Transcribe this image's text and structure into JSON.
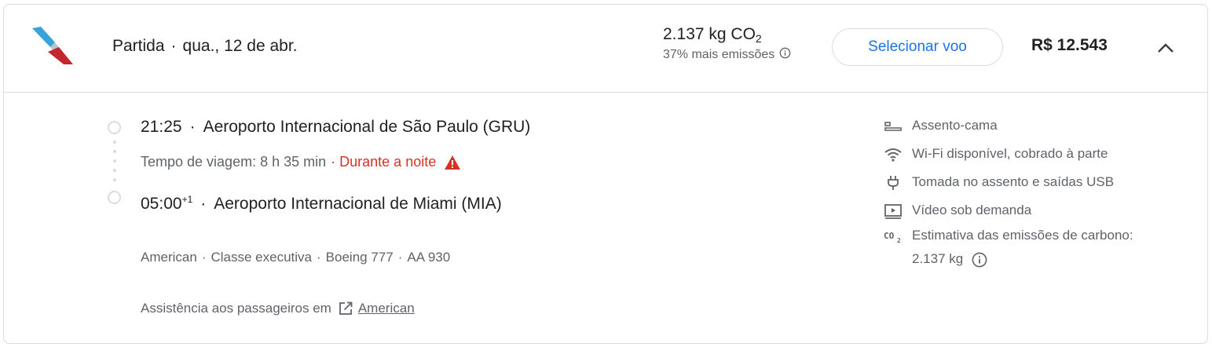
{
  "header": {
    "direction_label": "Partida",
    "date": "qua., 12 de abr.",
    "emissions_value": "2.137 kg CO",
    "emissions_sub": "2",
    "emissions_note": "37% mais emissões",
    "select_button": "Selecionar voo",
    "price": "R$ 12.543"
  },
  "segment": {
    "departure_time": "21:25",
    "departure_airport": "Aeroporto Internacional de São Paulo (GRU)",
    "travel_time": "Tempo de viagem: 8 h 35 min",
    "overnight_label": "Durante a noite",
    "arrival_time": "05:00",
    "arrival_day_offset": "+1",
    "arrival_airport": "Aeroporto Internacional de Miami (MIA)"
  },
  "details": {
    "airline": "American",
    "cabin": "Classe executiva",
    "aircraft": "Boeing 777",
    "flight_number": "AA 930"
  },
  "assistance": {
    "prefix": "Assistência aos passageiros em",
    "link": "American"
  },
  "amenities": [
    {
      "icon": "bed-seat-icon",
      "label": "Assento-cama"
    },
    {
      "icon": "wifi-icon",
      "label": "Wi-Fi disponível, cobrado à parte"
    },
    {
      "icon": "power-plug-icon",
      "label": "Tomada no assento e saídas USB"
    },
    {
      "icon": "video-icon",
      "label": "Vídeo sob demanda"
    },
    {
      "icon": "co2-icon",
      "label": "Estimativa das emissões de carbono:",
      "label2": "2.137 kg"
    }
  ],
  "colors": {
    "accent": "#1a73e8",
    "warning": "#d93025",
    "secondary_text": "#5f6368",
    "border": "#dadce0"
  }
}
